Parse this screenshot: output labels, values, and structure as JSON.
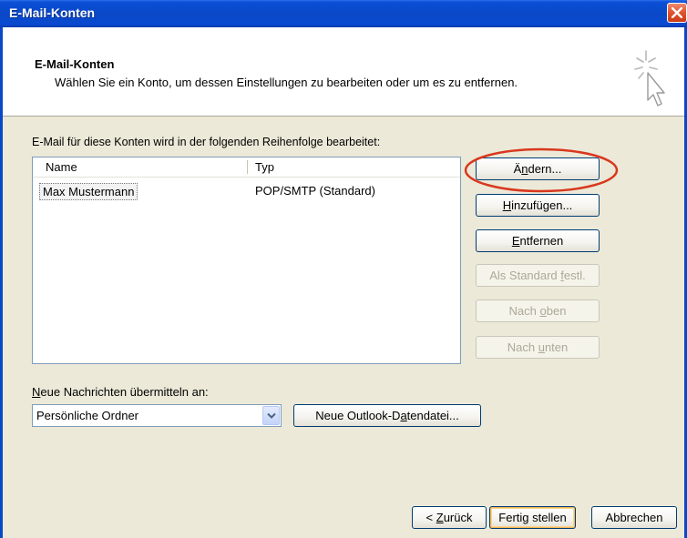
{
  "window": {
    "title": "E-Mail-Konten"
  },
  "header": {
    "title": "E-Mail-Konten",
    "subtitle": "Wählen Sie ein Konto, um dessen Einstellungen zu bearbeiten oder um es zu entfernen."
  },
  "accounts": {
    "intro": "E-Mail für diese Konten wird in der folgenden Reihenfolge bearbeitet:",
    "columns": {
      "name": "Name",
      "type": "Typ"
    },
    "rows": [
      {
        "name": "Max Mustermann",
        "type": "POP/SMTP (Standard)"
      }
    ]
  },
  "buttons": {
    "change": {
      "pre": "Ä",
      "u": "n",
      "post": "dern..."
    },
    "add": {
      "pre": "",
      "u": "H",
      "post": "inzufügen..."
    },
    "remove": {
      "pre": "",
      "u": "E",
      "post": "ntfernen"
    },
    "set_default": {
      "pre": "Als Standard ",
      "u": "f",
      "post": "estl."
    },
    "move_up": {
      "pre": "Nach ",
      "u": "o",
      "post": "ben"
    },
    "move_down": {
      "pre": "Nach ",
      "u": "u",
      "post": "nten"
    }
  },
  "delivery": {
    "label_u": "N",
    "label_rest": "eue Nachrichten übermitteln an:",
    "selected": "Persönliche Ordner",
    "new_file": {
      "pre": "Neue Outlook-D",
      "u": "a",
      "post": "tendatei..."
    }
  },
  "footer": {
    "back": {
      "pre": "< ",
      "u": "Z",
      "post": "urück"
    },
    "finish": "Fertig stellen",
    "cancel": "Abbrechen"
  },
  "colors": {
    "titlebar": "#0a48c7",
    "highlight_ellipse": "#d9381e",
    "dialog_bg": "#ece9d8"
  },
  "icons": {
    "close": "close-icon",
    "header": "cursor-sparkle-icon",
    "dropdown": "chevron-down-icon"
  }
}
